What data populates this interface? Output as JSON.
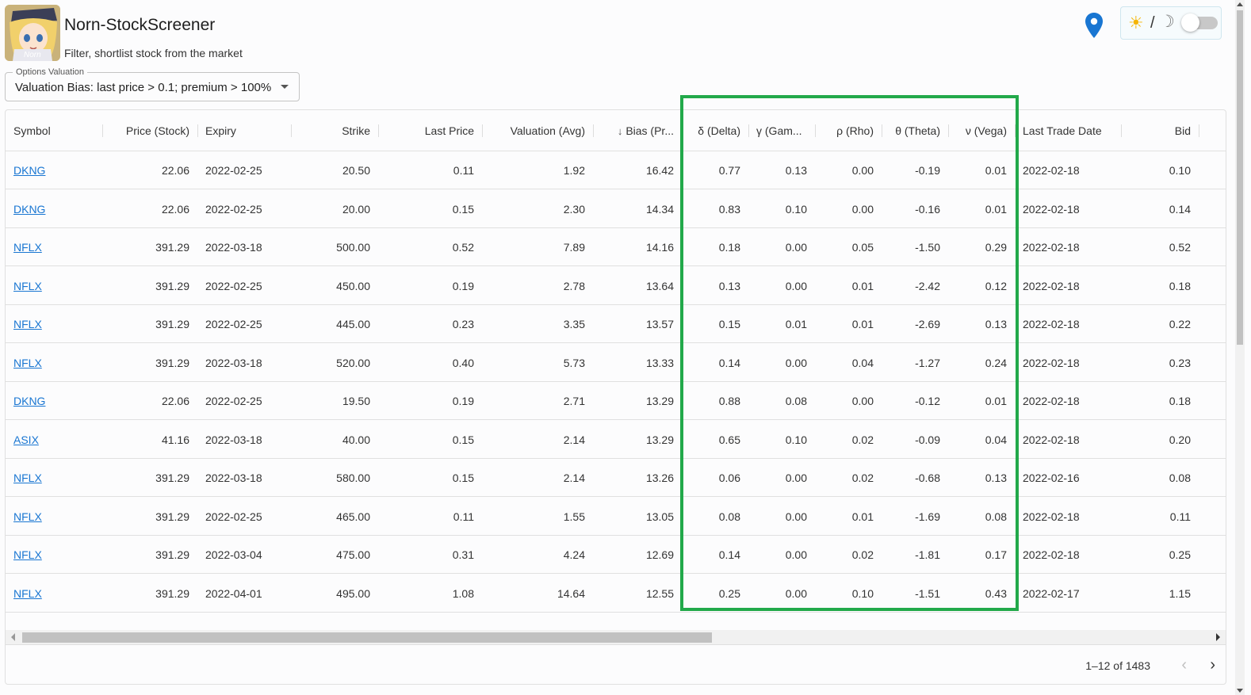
{
  "app": {
    "title": "Norn-StockScreener",
    "subtitle": "Filter, shortlist stock from the market",
    "avatar_text": "Norn"
  },
  "theme": {
    "sun": "☀",
    "slash": "/",
    "moon": "☽",
    "dark_mode": false
  },
  "filter": {
    "label": "Options Valuation",
    "value": "Valuation Bias: last price > 0.1; premium > 100%"
  },
  "grid": {
    "columns": [
      "Symbol",
      "Price (Stock)",
      "Expiry",
      "Strike",
      "Last Price",
      "Valuation (Avg)",
      "Bias (Pr...",
      "δ (Delta)",
      "γ (Gam...",
      "ρ (Rho)",
      "θ (Theta)",
      "ν (Vega)",
      "Last Trade Date",
      "Bid"
    ],
    "sort_column": "Bias (Pr...",
    "sort_direction": "descending",
    "rows": [
      [
        "DKNG",
        "22.06",
        "2022-02-25",
        "20.50",
        "0.11",
        "1.92",
        "16.42",
        "0.77",
        "0.13",
        "0.00",
        "-0.19",
        "0.01",
        "2022-02-18",
        "0.10"
      ],
      [
        "DKNG",
        "22.06",
        "2022-02-25",
        "20.00",
        "0.15",
        "2.30",
        "14.34",
        "0.83",
        "0.10",
        "0.00",
        "-0.16",
        "0.01",
        "2022-02-18",
        "0.14"
      ],
      [
        "NFLX",
        "391.29",
        "2022-03-18",
        "500.00",
        "0.52",
        "7.89",
        "14.16",
        "0.18",
        "0.00",
        "0.05",
        "-1.50",
        "0.29",
        "2022-02-18",
        "0.52"
      ],
      [
        "NFLX",
        "391.29",
        "2022-02-25",
        "450.00",
        "0.19",
        "2.78",
        "13.64",
        "0.13",
        "0.00",
        "0.01",
        "-2.42",
        "0.12",
        "2022-02-18",
        "0.18"
      ],
      [
        "NFLX",
        "391.29",
        "2022-02-25",
        "445.00",
        "0.23",
        "3.35",
        "13.57",
        "0.15",
        "0.01",
        "0.01",
        "-2.69",
        "0.13",
        "2022-02-18",
        "0.22"
      ],
      [
        "NFLX",
        "391.29",
        "2022-03-18",
        "520.00",
        "0.40",
        "5.73",
        "13.33",
        "0.14",
        "0.00",
        "0.04",
        "-1.27",
        "0.24",
        "2022-02-18",
        "0.23"
      ],
      [
        "DKNG",
        "22.06",
        "2022-02-25",
        "19.50",
        "0.19",
        "2.71",
        "13.29",
        "0.88",
        "0.08",
        "0.00",
        "-0.12",
        "0.01",
        "2022-02-18",
        "0.18"
      ],
      [
        "ASIX",
        "41.16",
        "2022-03-18",
        "40.00",
        "0.15",
        "2.14",
        "13.29",
        "0.65",
        "0.10",
        "0.02",
        "-0.09",
        "0.04",
        "2022-02-18",
        "0.20"
      ],
      [
        "NFLX",
        "391.29",
        "2022-03-18",
        "580.00",
        "0.15",
        "2.14",
        "13.26",
        "0.06",
        "0.00",
        "0.02",
        "-0.68",
        "0.13",
        "2022-02-16",
        "0.08"
      ],
      [
        "NFLX",
        "391.29",
        "2022-02-25",
        "465.00",
        "0.11",
        "1.55",
        "13.05",
        "0.08",
        "0.00",
        "0.01",
        "-1.69",
        "0.08",
        "2022-02-18",
        "0.11"
      ],
      [
        "NFLX",
        "391.29",
        "2022-03-04",
        "475.00",
        "0.31",
        "4.24",
        "12.69",
        "0.14",
        "0.00",
        "0.02",
        "-1.81",
        "0.17",
        "2022-02-18",
        "0.25"
      ],
      [
        "NFLX",
        "391.29",
        "2022-04-01",
        "495.00",
        "1.08",
        "14.64",
        "12.55",
        "0.25",
        "0.00",
        "0.10",
        "-1.51",
        "0.43",
        "2022-02-17",
        "1.15"
      ]
    ]
  },
  "pagination": {
    "text": "1–12 of 1483",
    "prev": "‹",
    "next": "›"
  },
  "colors": {
    "link": "#1976d2",
    "highlight": "#22a94a",
    "location_pin": "#1976d2",
    "sun": "#f5b400"
  }
}
